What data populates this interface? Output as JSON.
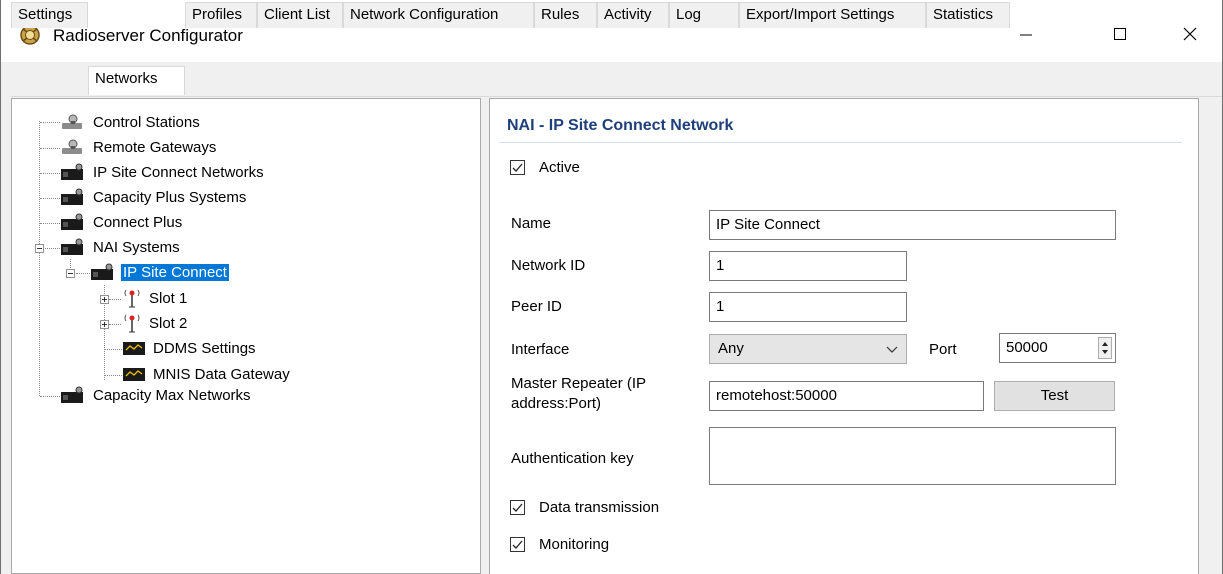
{
  "window": {
    "title": "Radioserver Configurator",
    "minimize_glyph": "—",
    "maximize_glyph": "☐",
    "close_glyph": "✕"
  },
  "tabs": [
    "Settings",
    "Networks",
    "Profiles",
    "Client List",
    "Network Configuration",
    "Rules",
    "Activity",
    "Log",
    "Export/Import Settings",
    "Statistics"
  ],
  "active_tab": "Networks",
  "tree": {
    "items": [
      {
        "label": "Control Stations",
        "icon": "control-station-icon"
      },
      {
        "label": "Remote Gateways",
        "icon": "remote-gateway-icon"
      },
      {
        "label": "IP Site Connect Networks",
        "icon": "network-icon"
      },
      {
        "label": "Capacity Plus Systems",
        "icon": "network-icon"
      },
      {
        "label": "Connect Plus",
        "icon": "network-icon"
      },
      {
        "label": "NAI Systems",
        "icon": "network-icon"
      },
      {
        "label": "IP Site Connect",
        "icon": "network-icon"
      },
      {
        "label": "Slot 1",
        "icon": "antenna-icon"
      },
      {
        "label": "Slot 2",
        "icon": "antenna-icon"
      },
      {
        "label": "DDMS Settings",
        "icon": "monitor-icon"
      },
      {
        "label": "MNIS Data Gateway",
        "icon": "monitor-icon"
      },
      {
        "label": "Capacity Max Networks",
        "icon": "network-icon"
      }
    ],
    "selected": "IP Site Connect"
  },
  "detail": {
    "heading": "NAI - IP Site Connect Network",
    "active_label": "Active",
    "active_checked": true,
    "name_label": "Name",
    "name_value": "IP Site Connect",
    "network_id_label": "Network ID",
    "network_id_value": "1",
    "peer_id_label": "Peer ID",
    "peer_id_value": "1",
    "interface_label": "Interface",
    "interface_value": "Any",
    "port_label": "Port",
    "port_value": "50000",
    "master_label_line1": "Master Repeater (IP",
    "master_label_line2": "address:Port)",
    "master_value": "remotehost:50000",
    "test_button": "Test",
    "auth_label": "Authentication key",
    "auth_value": "",
    "data_tx_label": "Data transmission",
    "data_tx_checked": true,
    "monitoring_label": "Monitoring",
    "monitoring_checked": true
  }
}
